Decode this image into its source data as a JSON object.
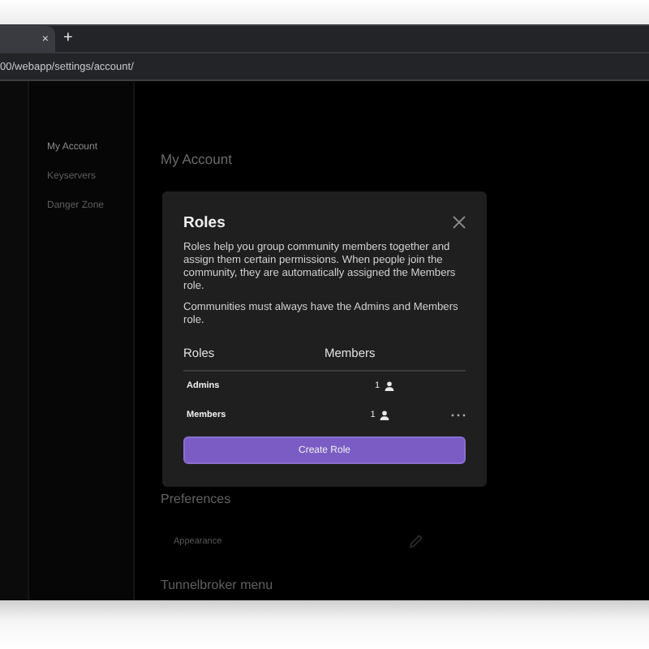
{
  "browser": {
    "tab_close": "×",
    "new_tab": "+",
    "url": "00/webapp/settings/account/"
  },
  "sidebar": {
    "items": [
      {
        "label": "My Account",
        "selected": true
      },
      {
        "label": "Keyservers",
        "selected": false
      },
      {
        "label": "Danger Zone",
        "selected": false
      }
    ]
  },
  "page": {
    "title": "My Account",
    "sections": [
      {
        "heading": "Preferences",
        "rows": [
          "Appearance"
        ]
      },
      {
        "heading": "Tunnelbroker menu"
      }
    ]
  },
  "modal": {
    "title": "Roles",
    "paragraphs": [
      "Roles help you group community members together and assign them certain permissions. When people join the community, they are automatically assigned the Members role.",
      "Communities must always have the Admins and Members role."
    ],
    "columns": [
      "Roles",
      "Members"
    ],
    "rows": [
      {
        "role": "Admins",
        "count": "1",
        "menu": false
      },
      {
        "role": "Members",
        "count": "1",
        "menu": true
      }
    ],
    "button": "Create Role"
  }
}
